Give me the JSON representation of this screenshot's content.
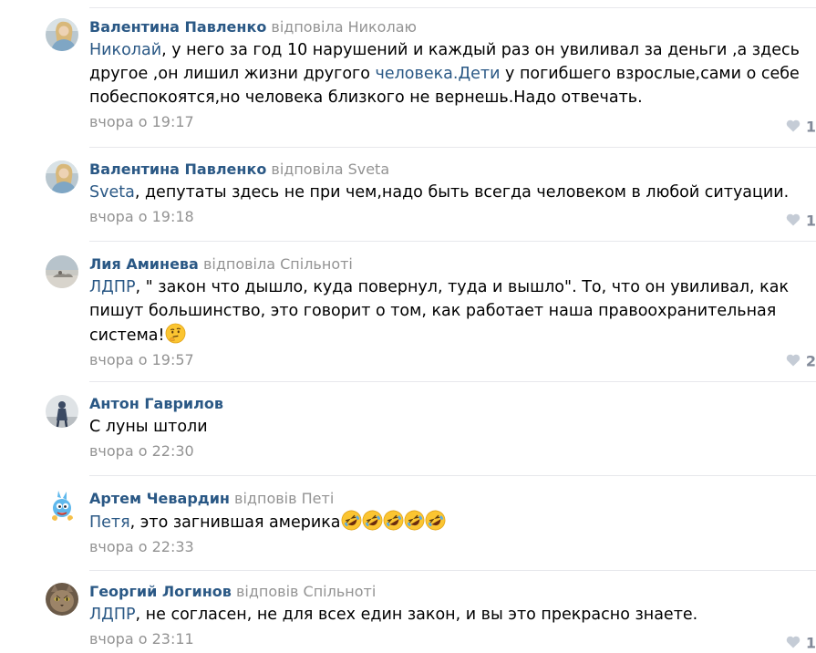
{
  "comments": [
    {
      "author": "Валентина Павленко",
      "replied": "відповіла Николаю",
      "link": "Николай",
      "line1": ", у него за год 10 нарушений и каждый раз он увиливал за деньги ,а здесь",
      "line2a": "другое ,он лишил жизни другого ",
      "link2": "человека.Дети",
      "line2b": " у погибшего взрослые,сами о себе",
      "line3": "побеспокоятся,но человека близкого не вернешь.Надо отвечать.",
      "date": "вчора о 19:17",
      "likes": "1"
    },
    {
      "author": "Валентина Павленко",
      "replied": "відповіла Sveta",
      "link": "Sveta",
      "line1": ", депутаты здесь не при чем,надо быть всегда человеком в любой ситуации.",
      "date": "вчора о 19:18",
      "likes": "1"
    },
    {
      "author": "Лия Аминева",
      "replied": "відповіла Спільноті",
      "link": "ЛДПР",
      "line1": ", \" закон что дышло, куда повернул, туда и вышло\". То, что он увиливал, как",
      "line2": "пишут большинство, это говорит о том, как работает наша правоохранительная",
      "line3": "система!",
      "date": "вчора о 19:57",
      "likes": "2"
    },
    {
      "author": "Антон Гаврилов",
      "line1": "С луны штоли",
      "date": "вчора о 22:30"
    },
    {
      "author": "Артем Чевардин",
      "replied": "відповів Петі",
      "link": "Петя",
      "line1": ", это загнившая америка",
      "date": "вчора о 22:33"
    },
    {
      "author": "Георгий Логинов",
      "replied": "відповів Спільноті",
      "link": "ЛДПР",
      "line1": ", не согласен, не для всех един закон, и вы это прекрасно знаете.",
      "date": "вчора о 23:11",
      "likes": "1"
    }
  ],
  "icons": {
    "like": "heart-icon",
    "thinking": "thinking-face-emoji",
    "laughing": "rolling-on-floor-laughing-emoji"
  },
  "colors": {
    "author": "#2a5885",
    "meta": "#939393",
    "divider": "#e7e8ec",
    "heart": "#c5ccd6"
  }
}
